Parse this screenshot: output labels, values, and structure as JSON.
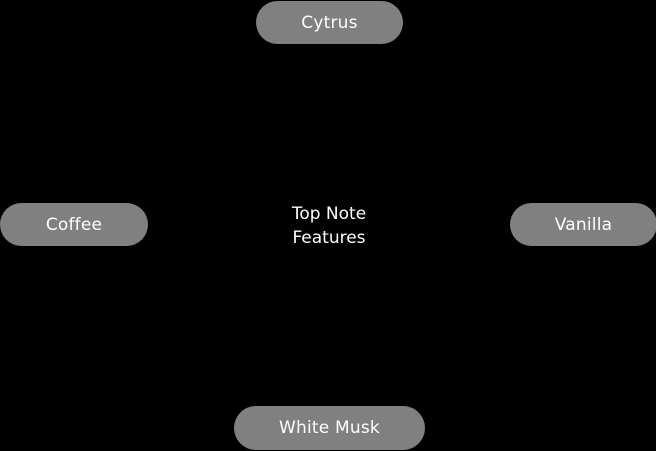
{
  "center": {
    "line1": "Top Note",
    "line2": "Features"
  },
  "nodes": {
    "top": "Cytrus",
    "left": "Coffee",
    "right": "Vanilla",
    "bottom": "White Musk"
  },
  "colors": {
    "background": "#000000",
    "node_fill": "#808080",
    "text": "#ffffff"
  }
}
